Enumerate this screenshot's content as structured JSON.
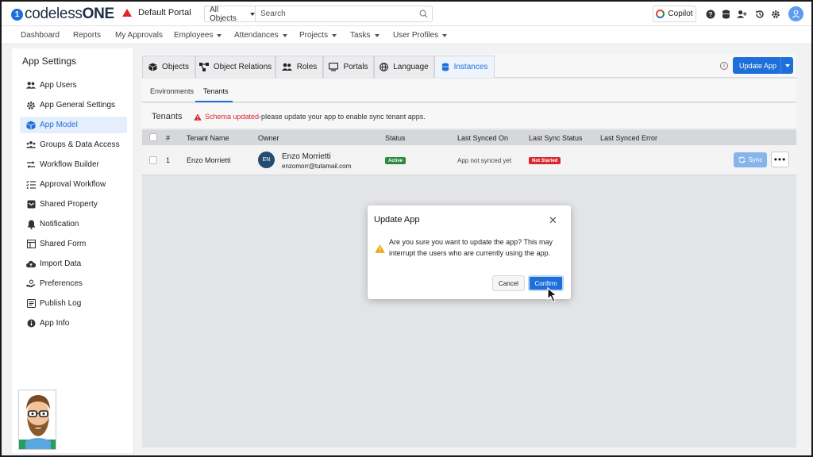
{
  "header": {
    "logo_prefix": "codeless",
    "logo_suffix": "ONE",
    "portal_name": "Default Portal",
    "search_scope": "All Objects",
    "search_placeholder": "Search",
    "copilot_label": "Copilot"
  },
  "menu": {
    "items": [
      {
        "label": "Dashboard"
      },
      {
        "label": "Reports"
      },
      {
        "label": "My Approvals"
      },
      {
        "label": "Employees"
      },
      {
        "label": "Attendances"
      },
      {
        "label": "Projects"
      },
      {
        "label": "Tasks"
      },
      {
        "label": "User Profiles"
      }
    ]
  },
  "sidebar": {
    "title": "App Settings",
    "items": [
      {
        "label": "App Users",
        "icon": "users-icon"
      },
      {
        "label": "App General Settings",
        "icon": "gear-icon"
      },
      {
        "label": "App Model",
        "icon": "cube-icon",
        "active": true
      },
      {
        "label": "Groups & Data Access",
        "icon": "groups-icon"
      },
      {
        "label": "Workflow Builder",
        "icon": "arrows-icon"
      },
      {
        "label": "Approval Workflow",
        "icon": "checklist-icon"
      },
      {
        "label": "Shared Property",
        "icon": "inbox-icon"
      },
      {
        "label": "Notification",
        "icon": "bell-icon"
      },
      {
        "label": "Shared Form",
        "icon": "form-icon"
      },
      {
        "label": "Import Data",
        "icon": "cloud-upload-icon"
      },
      {
        "label": "Preferences",
        "icon": "hand-icon"
      },
      {
        "label": "Publish Log",
        "icon": "log-icon"
      },
      {
        "label": "App Info",
        "icon": "info-icon"
      }
    ]
  },
  "tabs": {
    "items": [
      {
        "label": "Objects"
      },
      {
        "label": "Object Relations"
      },
      {
        "label": "Roles"
      },
      {
        "label": "Portals"
      },
      {
        "label": "Language"
      },
      {
        "label": "Instances",
        "active": true
      }
    ],
    "update_app_label": "Update App"
  },
  "subtabs": {
    "environments": "Environments",
    "tenants": "Tenants"
  },
  "tenants": {
    "label": "Tenants",
    "warning_strong": "Schema updated",
    "warning_rest": "-please update your app to enable sync tenant apps."
  },
  "table": {
    "headers": {
      "num": "#",
      "tenant_name": "Tenant Name",
      "owner": "Owner",
      "status": "Status",
      "last_synced_on": "Last Synced On",
      "last_sync_status": "Last Sync Status",
      "last_synced_error": "Last Synced Error"
    },
    "rows": [
      {
        "num": "1",
        "tenant_name": "Enzo Morrietti",
        "owner_initials": "EN",
        "owner_name": "Enzo Morrietti",
        "owner_email": "enzomorr@tutamail.com",
        "status": "Active",
        "last_synced_on": "App not synced yet",
        "last_sync_status": "Not Started",
        "sync_label": "Sync",
        "more_label": "•••"
      }
    ]
  },
  "modal": {
    "title": "Update App",
    "message": "Are you sure you want to update the app? This may interrupt the users who are currently using the app.",
    "cancel_label": "Cancel",
    "confirm_label": "Confirm"
  },
  "colors": {
    "accent": "#1e6fd9",
    "active_badge": "#2b8a3e",
    "not_started_badge": "#d8262e",
    "warning": "#f0a500"
  }
}
